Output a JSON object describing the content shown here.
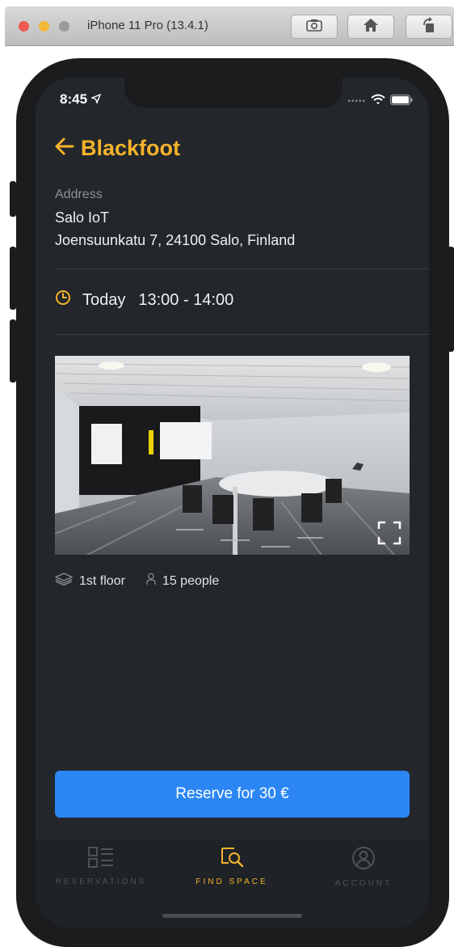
{
  "simulator": {
    "title": "iPhone 11 Pro (13.4.1)",
    "buttons": [
      "screenshot-icon",
      "home-icon",
      "rotate-icon"
    ]
  },
  "status_bar": {
    "time": "8:45",
    "indicators": [
      "location-arrow-icon",
      "signal-dots-icon",
      "wifi-icon",
      "battery-icon"
    ]
  },
  "header": {
    "title": "Blackfoot",
    "back_icon": "arrow-left-icon"
  },
  "address": {
    "label": "Address",
    "name": "Salo IoT",
    "street": "Joensuunkatu 7, 24100 Salo, Finland"
  },
  "time_slot": {
    "day": "Today",
    "range": "13:00 - 14:00",
    "icon": "clock-icon"
  },
  "room": {
    "floor": "1st floor",
    "capacity": "15 people",
    "floor_icon": "layers-icon",
    "capacity_icon": "person-icon"
  },
  "reserve": {
    "label": "Reserve for 30 €"
  },
  "tabs": [
    {
      "label": "RESERVATIONS",
      "icon": "list-icon",
      "active": false
    },
    {
      "label": "FIND SPACE",
      "icon": "find-space-icon",
      "active": true
    },
    {
      "label": "ACCOUNT",
      "icon": "account-icon",
      "active": false
    }
  ],
  "colors": {
    "accent": "#f5b32b",
    "primary_button": "#2b86f4",
    "background": "#23272b",
    "tab_inactive": "#4e5359"
  }
}
